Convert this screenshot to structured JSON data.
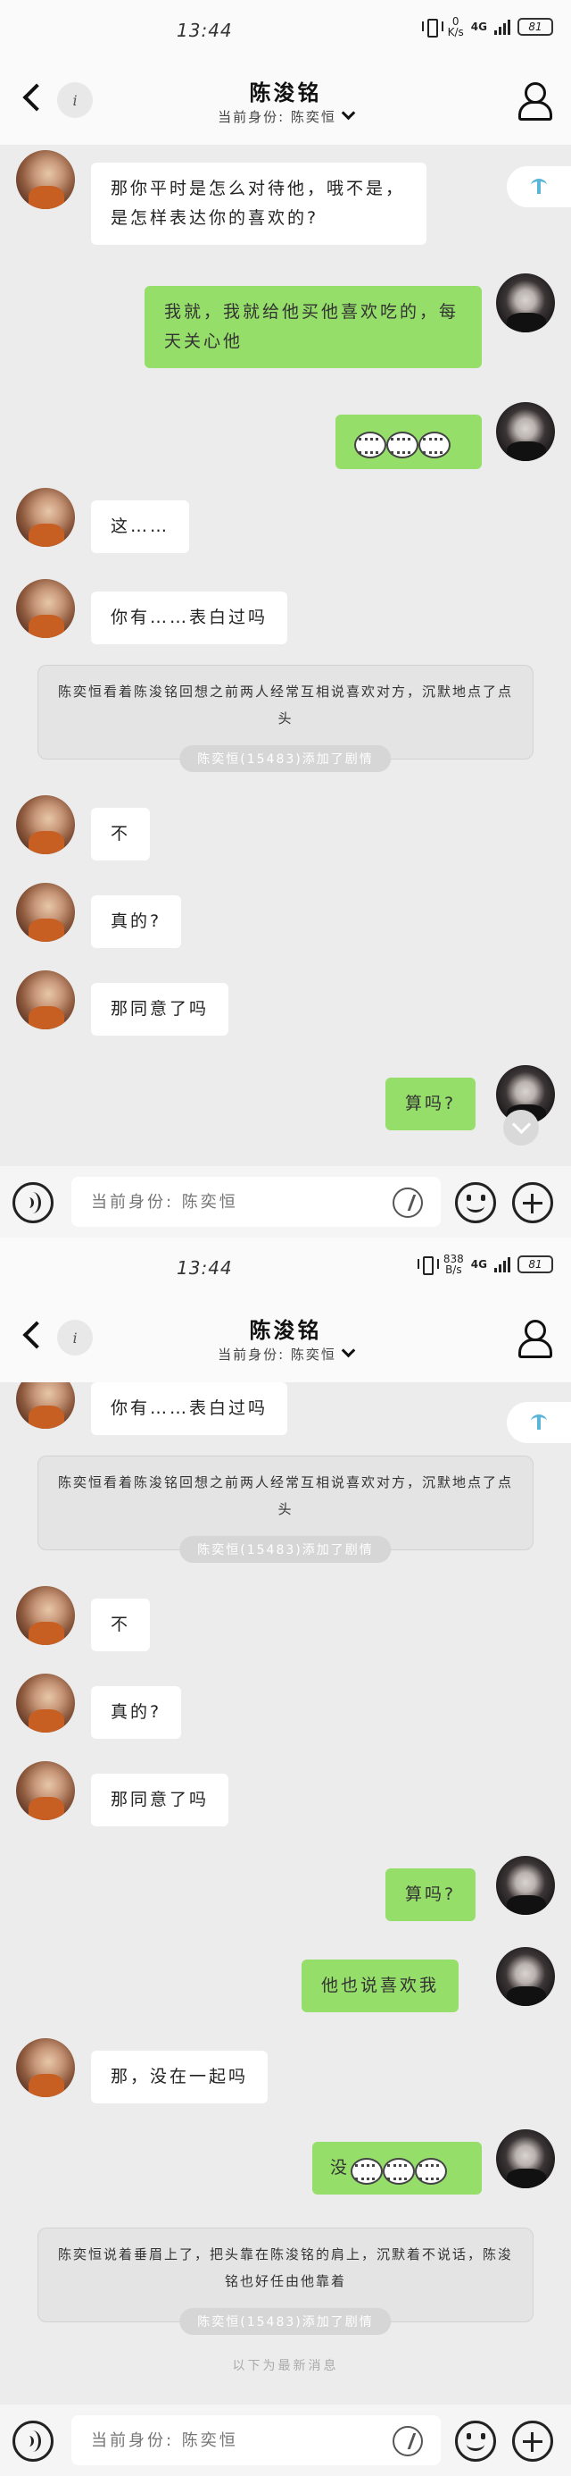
{
  "status_bar": {
    "time": "13:44",
    "speed_screen1": [
      "0",
      "K/s"
    ],
    "speed_screen2": [
      "838",
      "B/s"
    ],
    "network": "4G",
    "battery": "81"
  },
  "header": {
    "info": "i",
    "title": "陈浚铭",
    "identity": "当前身份: 陈奕恒"
  },
  "input": {
    "placeholder": "当前身份: 陈奕恒"
  },
  "screen1": {
    "messages": [
      {
        "text": "那你平时是怎么对待他，哦不是，是怎样表达你的喜欢的?"
      },
      {
        "text": "我就，我就给他买他喜欢吃的，每天关心他"
      },
      {
        "text": ""
      },
      {
        "text": "这……"
      },
      {
        "text": "你有……表白过吗"
      },
      {
        "text": "不"
      },
      {
        "text": "真的?"
      },
      {
        "text": "那同意了吗"
      },
      {
        "text": "算吗?"
      }
    ],
    "narration": {
      "text": "陈奕恒看着陈浚铭回想之前两人经常互相说喜欢对方，沉默地点了点头",
      "tag": "陈奕恒(15483)添加了剧情"
    }
  },
  "screen2": {
    "messages": [
      {
        "text": "你有……表白过吗"
      },
      {
        "text": "不"
      },
      {
        "text": "真的?"
      },
      {
        "text": "那同意了吗"
      },
      {
        "text": "算吗?"
      },
      {
        "text": "他也说喜欢我"
      },
      {
        "text": "那，没在一起吗"
      },
      {
        "text": "没"
      }
    ],
    "narration1": {
      "text": "陈奕恒看着陈浚铭回想之前两人经常互相说喜欢对方，沉默地点了点头",
      "tag": "陈奕恒(15483)添加了剧情"
    },
    "narration2": {
      "text": "陈奕恒说着垂眉上了，把头靠在陈浚铭的肩上，沉默着不说话，陈浚铭也好任由他靠着",
      "tag": "陈奕恒(15483)添加了剧情"
    },
    "new_msg_divider": "以下为最新消息"
  }
}
